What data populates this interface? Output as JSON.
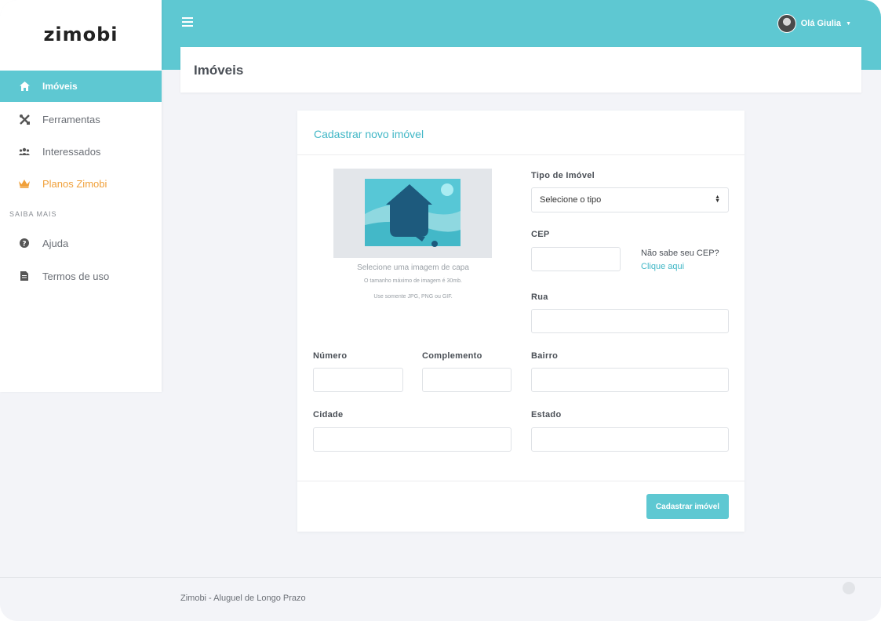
{
  "sidebar": {
    "logo": "zimobi",
    "items": [
      {
        "label": "Imóveis",
        "icon": "home-icon"
      },
      {
        "label": "Ferramentas",
        "icon": "tools-icon"
      },
      {
        "label": "Interessados",
        "icon": "users-icon"
      },
      {
        "label": "Planos Zimobi",
        "icon": "crown-icon"
      }
    ],
    "section_title": "SAIBA MAIS",
    "section_items": [
      {
        "label": "Ajuda",
        "icon": "question-icon"
      },
      {
        "label": "Termos de uso",
        "icon": "document-icon"
      }
    ]
  },
  "topbar": {
    "user_greeting": "Olá Giulia"
  },
  "page": {
    "title": "Imóveis"
  },
  "form": {
    "title": "Cadastrar novo imóvel",
    "image": {
      "caption": "Selecione uma imagem de capa",
      "max_size": "O tamanho máximo de imagem é 30mb.",
      "formats": "Use somente JPG, PNG ou GIF."
    },
    "tipo_label": "Tipo de Imóvel",
    "tipo_value": "Selecione o tipo",
    "cep_label": "CEP",
    "cep_help": "Não sabe seu CEP?",
    "cep_link": "Clique aqui",
    "rua_label": "Rua",
    "numero_label": "Número",
    "complemento_label": "Complemento",
    "bairro_label": "Bairro",
    "cidade_label": "Cidade",
    "estado_label": "Estado",
    "submit_label": "Cadastrar imóvel"
  },
  "footer": {
    "text": "Zimobi - Aluguel de Longo Prazo"
  },
  "colors": {
    "accent": "#5ec8d2",
    "link": "#41b7c6",
    "premium": "#f0a03a"
  }
}
